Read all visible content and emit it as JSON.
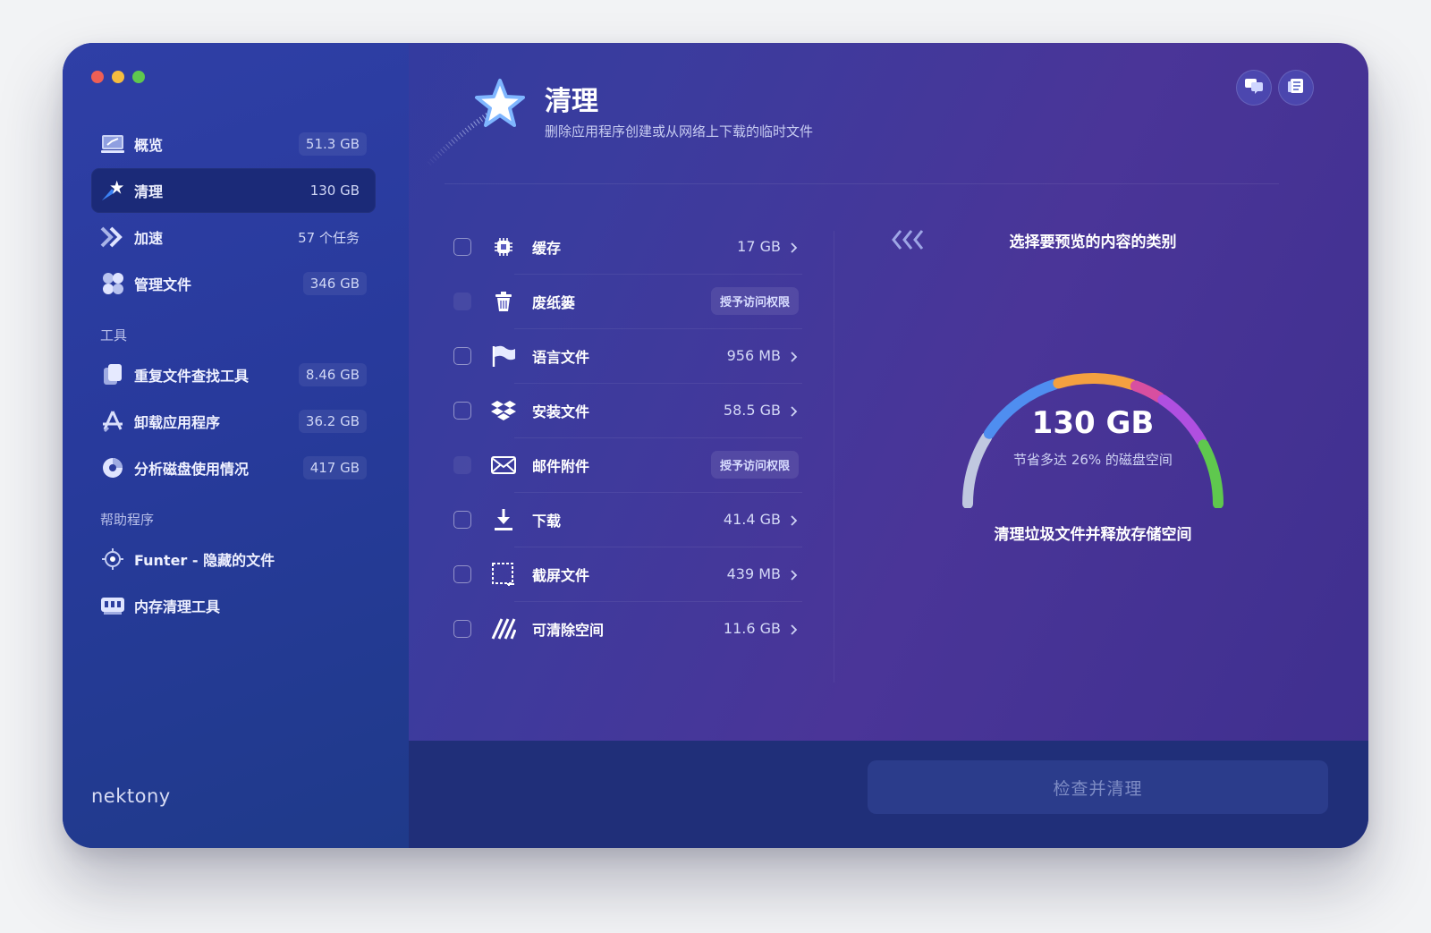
{
  "window": {
    "traffic_lights": [
      "close",
      "minimize",
      "zoom"
    ]
  },
  "sidebar": {
    "items": [
      {
        "label": "概览",
        "badge": "51.3 GB",
        "icon": "overview-icon"
      },
      {
        "label": "清理",
        "badge": "130 GB",
        "icon": "cleanup-icon",
        "active": true
      },
      {
        "label": "加速",
        "badge": "57 个任务",
        "icon": "speedup-icon"
      },
      {
        "label": "管理文件",
        "badge": "346 GB",
        "icon": "manage-files-icon"
      }
    ],
    "tools_label": "工具",
    "tools": [
      {
        "label": "重复文件查找工具",
        "badge": "8.46 GB",
        "icon": "duplicate-files-icon"
      },
      {
        "label": "卸载应用程序",
        "badge": "36.2 GB",
        "icon": "uninstall-icon"
      },
      {
        "label": "分析磁盘使用情况",
        "badge": "417 GB",
        "icon": "disk-usage-icon"
      }
    ],
    "helpers_label": "帮助程序",
    "helpers": [
      {
        "label": "Funter - 隐藏的文件",
        "icon": "funter-icon"
      },
      {
        "label": "内存清理工具",
        "icon": "memory-icon"
      }
    ],
    "brand": "nektony"
  },
  "header": {
    "title": "清理",
    "subtitle": "删除应用程序创建或从网络上下载的临时文件"
  },
  "categories": [
    {
      "label": "缓存",
      "size": "17 GB",
      "icon": "cpu-cache-icon"
    },
    {
      "label": "废纸篓",
      "action": "授予访问权限",
      "icon": "trash-icon"
    },
    {
      "label": "语言文件",
      "size": "956 MB",
      "icon": "flag-icon"
    },
    {
      "label": "安装文件",
      "size": "58.5 GB",
      "icon": "dropbox-icon"
    },
    {
      "label": "邮件附件",
      "action": "授予访问权限",
      "icon": "mail-icon"
    },
    {
      "label": "下载",
      "size": "41.4 GB",
      "icon": "download-icon"
    },
    {
      "label": "截屏文件",
      "size": "439 MB",
      "icon": "screenshot-icon"
    },
    {
      "label": "可清除空间",
      "size": "11.6 GB",
      "icon": "purgeable-icon"
    }
  ],
  "preview": {
    "title": "选择要预览的内容的类别",
    "value": "130 GB",
    "subtitle": "节省多达 26% 的磁盘空间",
    "caption": "清理垃圾文件并释放存储空间",
    "segment_colors": [
      "#c0c8e0",
      "#4f8ef0",
      "#f4a040",
      "#d84fa0",
      "#b04fe0",
      "#5fc84e"
    ]
  },
  "footer": {
    "button": "检查并清理"
  }
}
